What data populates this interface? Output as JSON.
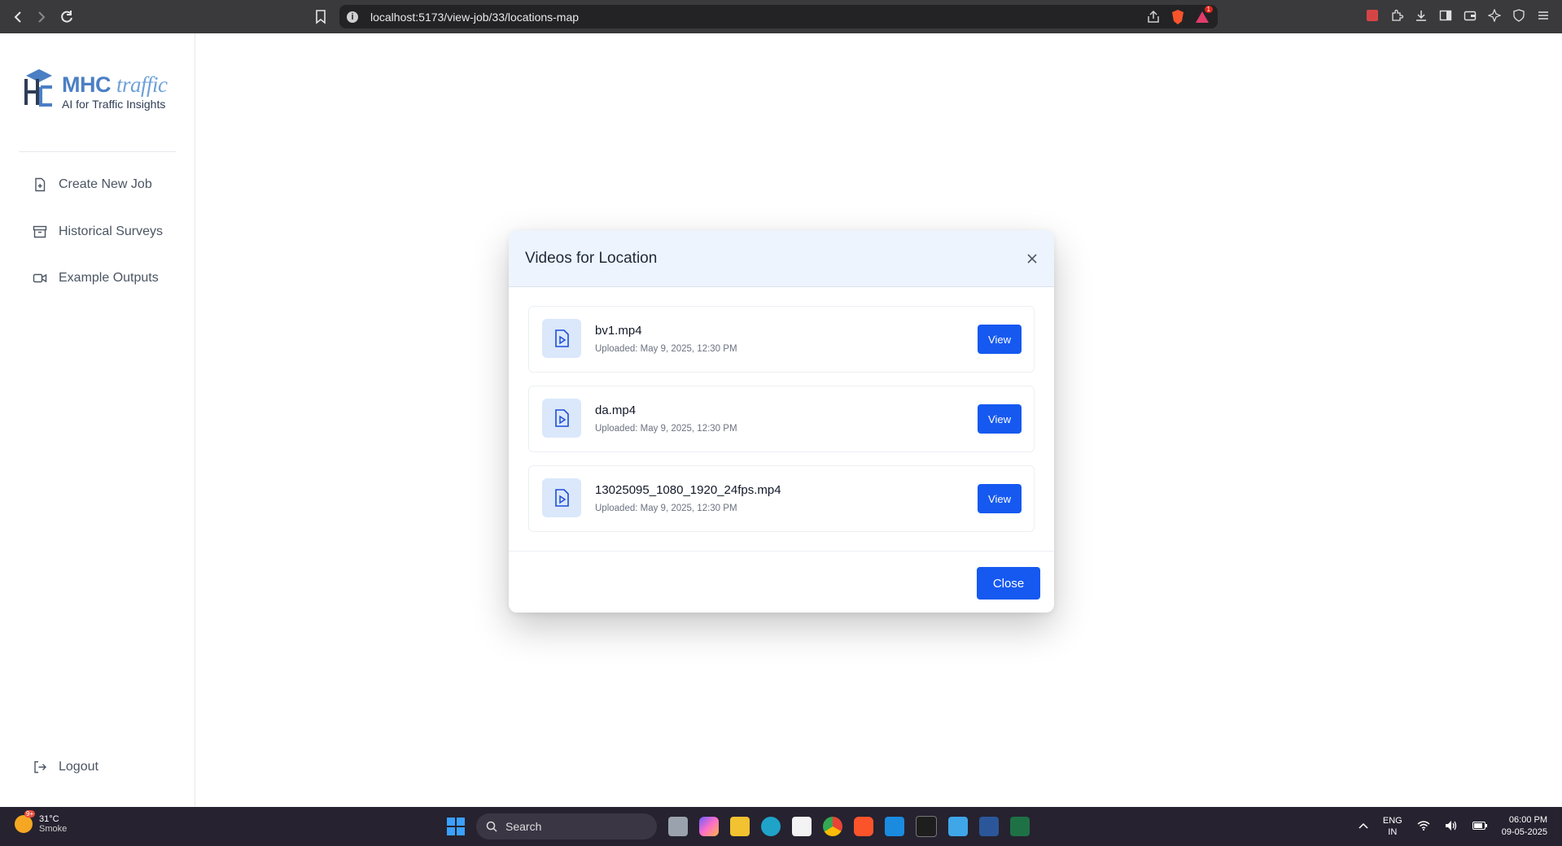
{
  "browser": {
    "url_host": "localhost",
    "url_path": ":5173/view-job/33/locations-map",
    "extension_badge": "1"
  },
  "sidebar": {
    "logo_brand_bold": "MHC",
    "logo_brand_light": "traffic",
    "logo_tagline": "AI for Traffic Insights",
    "items": [
      {
        "label": "Create New Job",
        "icon": "file-plus-icon"
      },
      {
        "label": "Historical Surveys",
        "icon": "archive-icon"
      },
      {
        "label": "Example Outputs",
        "icon": "video-camera-icon"
      }
    ],
    "logout_label": "Logout"
  },
  "modal": {
    "title": "Videos for Location",
    "close_label": "Close",
    "view_label": "View",
    "videos": [
      {
        "name": "bv1.mp4",
        "uploaded": "Uploaded: May 9, 2025, 12:30 PM"
      },
      {
        "name": "da.mp4",
        "uploaded": "Uploaded: May 9, 2025, 12:30 PM"
      },
      {
        "name": "13025095_1080_1920_24fps.mp4",
        "uploaded": "Uploaded: May 9, 2025, 12:30 PM"
      }
    ]
  },
  "taskbar": {
    "weather_temp": "31°C",
    "weather_desc": "Smoke",
    "weather_badge": "9+",
    "search_placeholder": "Search",
    "lang_line1": "ENG",
    "lang_line2": "IN",
    "time": "06:00 PM",
    "date": "09-05-2025"
  },
  "colors": {
    "accent": "#1659f0",
    "modal_header_bg": "#eef4fd",
    "chrome_bg": "#3a3a3d",
    "taskbar_bg": "#262230"
  }
}
